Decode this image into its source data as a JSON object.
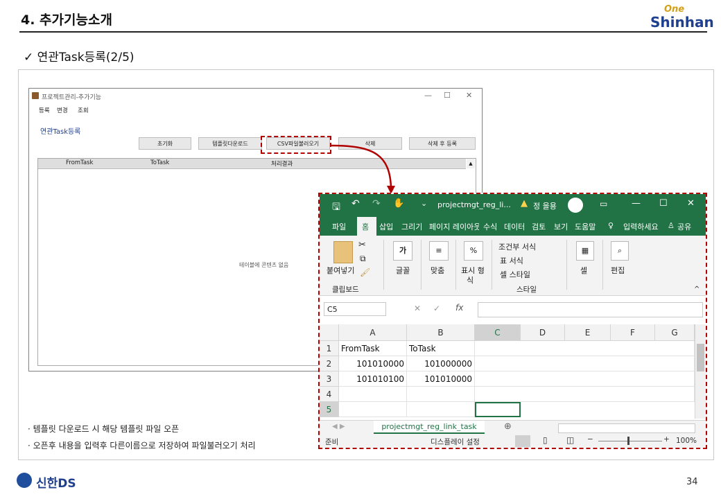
{
  "slide": {
    "title": "4. 추가기능소개",
    "brand_top": "One",
    "brand_bottom": "Shinhan",
    "subtitle": "✓  연관Task등록(2/5)",
    "footer_logo": "신한DS",
    "page_number": "34"
  },
  "app": {
    "title": "프로젝트관리-추가기능",
    "menu": [
      "등록",
      "변경",
      "조회"
    ],
    "heading": "연관Task등록",
    "buttons": [
      "초기화",
      "템플릿다운로드",
      "CSV파일불러오기",
      "삭제",
      "삭제 후 등록"
    ],
    "grid_headers": [
      "FromTask",
      "ToTask",
      "처리결과"
    ],
    "grid_empty": "테이블에 콘텐츠 없음"
  },
  "excel": {
    "filename": "projectmgt_reg_li...",
    "user": "정 을용",
    "warning_icon": "warning-icon",
    "tabs": [
      "파일",
      "홈",
      "삽입",
      "그리기",
      "페이지 레이아웃",
      "수식",
      "데이터",
      "검토",
      "보기",
      "도움말",
      "입력하세요",
      "공유"
    ],
    "active_tab": "홈",
    "ribbon": {
      "paste": "붙여넣기",
      "clipboard": "클립보드",
      "font": "글꼴",
      "align": "맞춤",
      "number_a": "표시 형",
      "number_b": "식",
      "cond_format": "조건부 서식",
      "table_format": "표 서식",
      "cell_style": "셀 스타일",
      "style_group": "스타일",
      "cells": "셀",
      "editing": "편집"
    },
    "name_box": "C5",
    "columns": [
      "A",
      "B",
      "C",
      "D",
      "E",
      "F",
      "G"
    ],
    "rows": [
      [
        "1",
        "FromTask",
        "ToTask"
      ],
      [
        "2",
        "101010000",
        "101000000"
      ],
      [
        "3",
        "101010100",
        "101010000"
      ],
      [
        "4",
        "",
        ""
      ],
      [
        "5",
        "",
        ""
      ]
    ],
    "sheet_tab": "projectmgt_reg_link_task",
    "status_ready": "준비",
    "display_settings": "디스플레이 설정",
    "zoom": "100%",
    "accent": "#217346"
  },
  "notes": [
    "· 템플릿 다운로드 시 해당 템플릿 파일 오픈",
    "· 오픈후 내용을 입력후 다른이름으로 저장하여 파일불러오기 처리"
  ],
  "colors": {
    "highlight": "#b00000",
    "brand_blue": "#1f3f8f"
  }
}
